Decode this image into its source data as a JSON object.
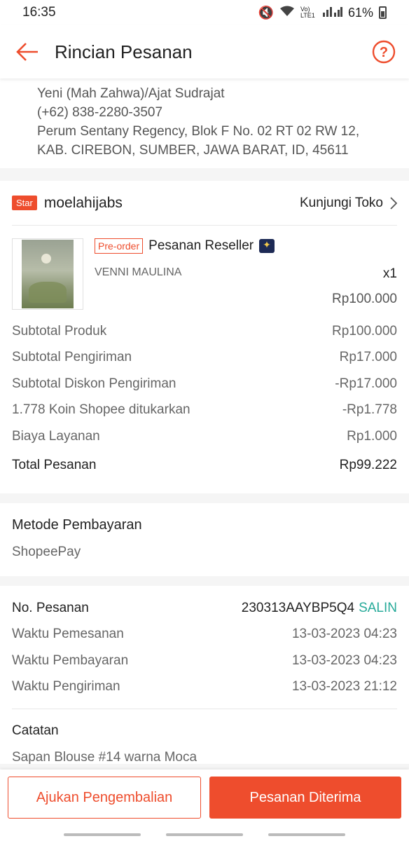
{
  "status_bar": {
    "time": "16:35",
    "battery": "61%",
    "network": "Vo) LTE1"
  },
  "header": {
    "title": "Rincian Pesanan"
  },
  "address": {
    "name": "Yeni (Mah Zahwa)/Ajat Sudrajat",
    "phone": "(+62) 838-2280-3507",
    "line1": "Perum Sentany Regency, Blok F No. 02 RT 02 RW 12,",
    "line2": "KAB. CIREBON, SUMBER, JAWA BARAT, ID, 45611"
  },
  "shop": {
    "badge": "Star",
    "name": "moelahijabs",
    "visit_label": "Kunjungi Toko"
  },
  "product": {
    "tag": "Pre-order",
    "name": "Pesanan Reseller",
    "variant": "VENNI MAULINA",
    "quantity": "x1",
    "price": "Rp100.000"
  },
  "summary": {
    "rows": [
      {
        "label": "Subtotal Produk",
        "value": "Rp100.000"
      },
      {
        "label": "Subtotal Pengiriman",
        "value": "Rp17.000"
      },
      {
        "label": "Subtotal Diskon Pengiriman",
        "value": "-Rp17.000"
      },
      {
        "label": "1.778 Koin Shopee ditukarkan",
        "value": "-Rp1.778"
      },
      {
        "label": "Biaya Layanan",
        "value": "Rp1.000"
      }
    ],
    "total_label": "Total Pesanan",
    "total_value": "Rp99.222"
  },
  "payment": {
    "title": "Metode Pembayaran",
    "method": "ShopeePay"
  },
  "order_info": {
    "order_no_label": "No. Pesanan",
    "order_no": "230313AAYBP5Q4",
    "copy_label": "SALIN",
    "rows": [
      {
        "label": "Waktu Pemesanan",
        "value": "13-03-2023 04:23"
      },
      {
        "label": "Waktu Pembayaran",
        "value": "13-03-2023 04:23"
      },
      {
        "label": "Waktu Pengiriman",
        "value": "13-03-2023 21:12"
      }
    ],
    "notes_title": "Catatan",
    "notes_text": "Sapan Blouse #14 warna Moca"
  },
  "actions": {
    "return_label": "Ajukan Pengembalian",
    "received_label": "Pesanan Diterima"
  },
  "colors": {
    "accent": "#ee4d2d",
    "copy": "#26aa99"
  }
}
